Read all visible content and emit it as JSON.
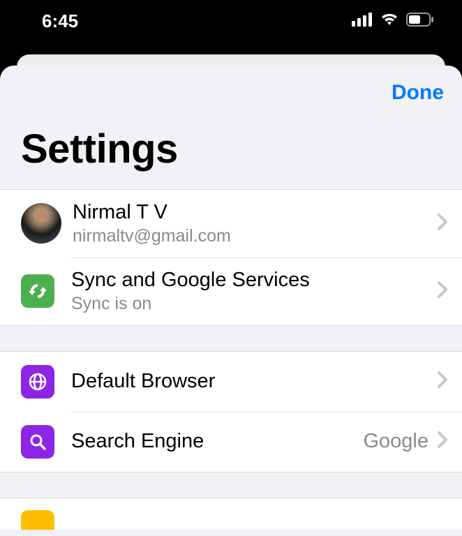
{
  "status": {
    "time": "6:45"
  },
  "header": {
    "done_label": "Done",
    "title": "Settings"
  },
  "account": {
    "name": "Nirmal T V",
    "email": "nirmaltv@gmail.com"
  },
  "sync": {
    "title": "Sync and Google Services",
    "subtitle": "Sync is on"
  },
  "default_browser": {
    "label": "Default Browser"
  },
  "search_engine": {
    "label": "Search Engine",
    "value": "Google"
  }
}
